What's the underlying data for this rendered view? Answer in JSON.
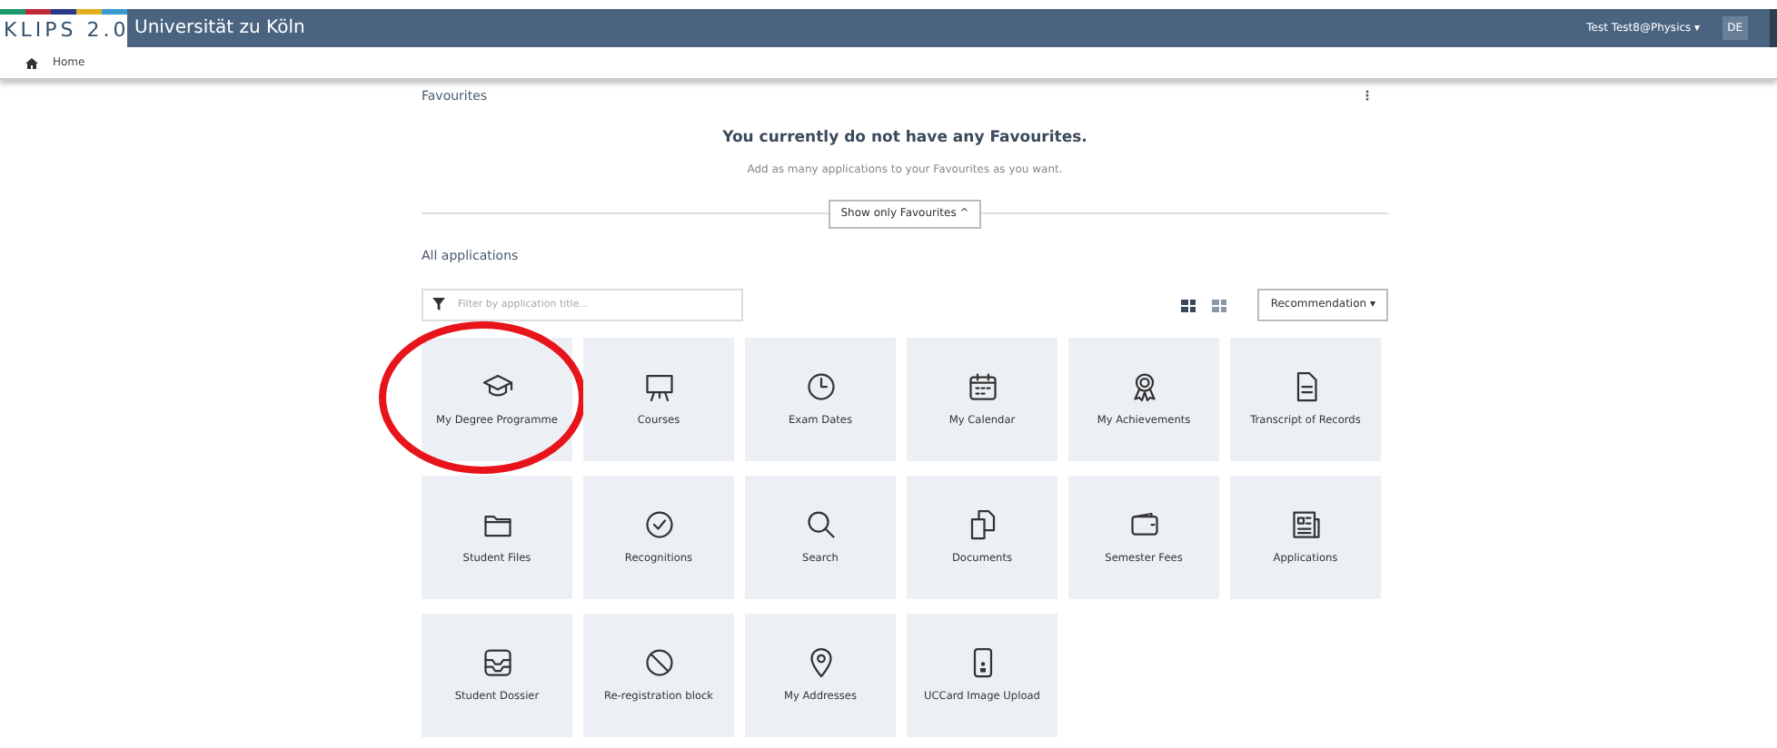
{
  "header": {
    "logo": "KLIPS 2.0",
    "university": "Universität zu Köln",
    "user": "Test Test8@Physics",
    "user_caret": "▾",
    "language": {
      "label": "DE",
      "selected": true
    }
  },
  "breadcrumb": {
    "items": [
      "Home"
    ]
  },
  "favourites": {
    "title": "Favourites",
    "menu": "⋮",
    "empty_title": "You currently do not have any Favourites.",
    "empty_text": "Add as many applications to your Favourites as you want.",
    "toggle_button": "Show only Favourites",
    "toggle_caret": "^"
  },
  "applications": {
    "title": "All applications",
    "filter": {
      "placeholder": "Filter by application title..."
    },
    "views": [
      {
        "selected": true
      },
      {
        "selected": false
      }
    ],
    "sort": "Recommendation",
    "sort_caret": "▾",
    "tiles": [
      {
        "label": "My Degree Programme",
        "highlighted": true
      },
      {
        "label": "Courses",
        "highlighted": false
      },
      {
        "label": "Exam Dates",
        "highlighted": false
      },
      {
        "label": "My Calendar",
        "highlighted": false
      },
      {
        "label": "My Achievements",
        "highlighted": false
      },
      {
        "label": "Transcript of Records",
        "highlighted": false
      },
      {
        "label": "Student Files",
        "highlighted": false
      },
      {
        "label": "Recognitions",
        "highlighted": false
      },
      {
        "label": "Search",
        "highlighted": false
      },
      {
        "label": "Documents",
        "highlighted": false
      },
      {
        "label": "Semester Fees",
        "highlighted": false
      },
      {
        "label": "Applications",
        "highlighted": false
      },
      {
        "label": "Student Dossier",
        "highlighted": false
      },
      {
        "label": "Re-registration block",
        "highlighted": false
      },
      {
        "label": "My Addresses",
        "highlighted": false
      },
      {
        "label": "UCCard Image Upload",
        "highlighted": false
      }
    ]
  }
}
